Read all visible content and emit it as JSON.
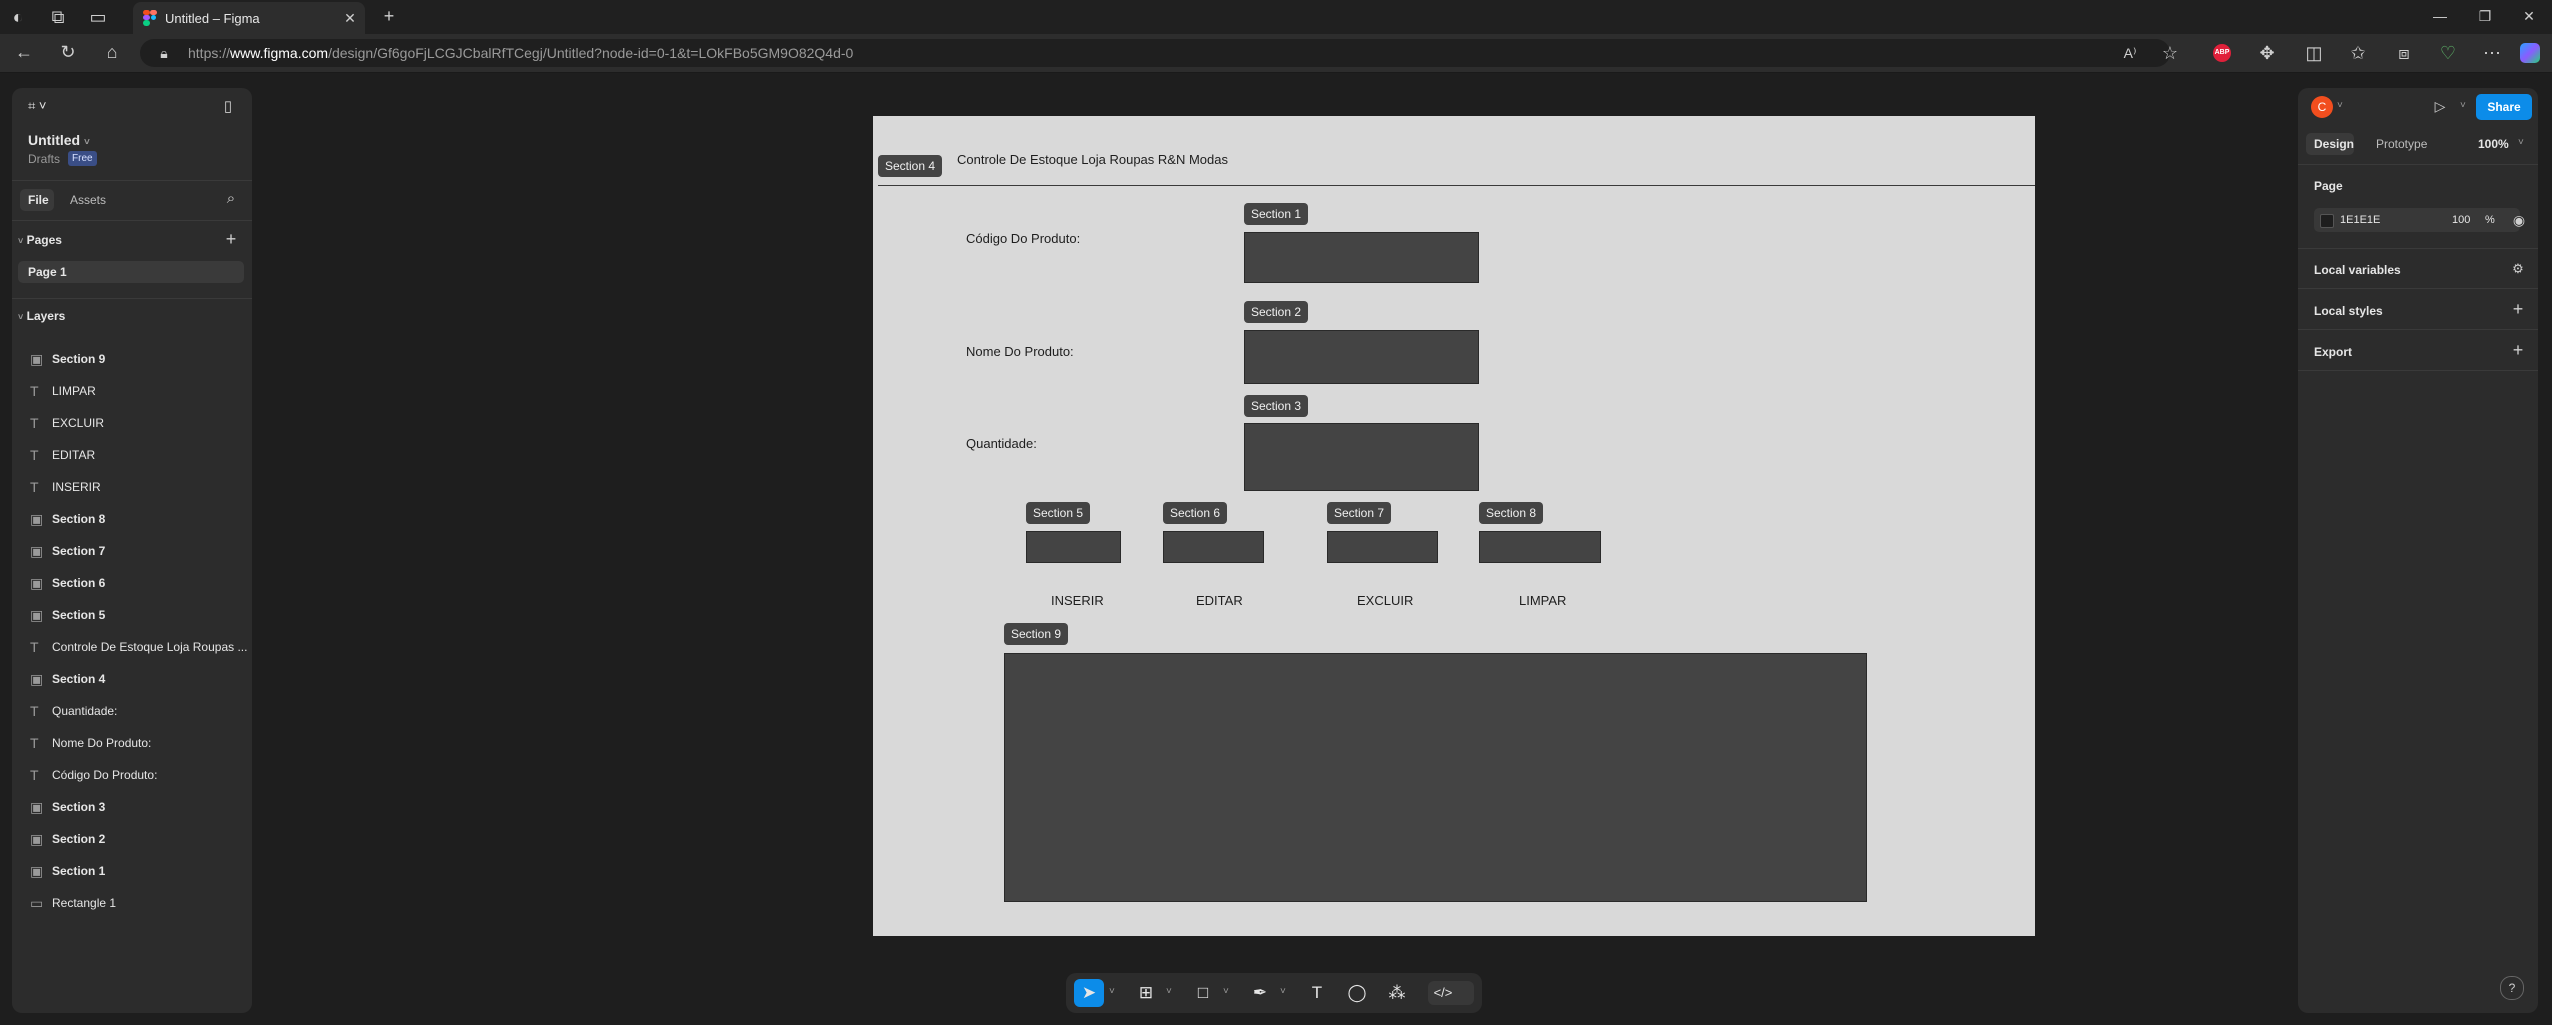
{
  "browser": {
    "tab_title": "Untitled – Figma",
    "new_tab_icon": "plus-icon",
    "url_prefix": "https://",
    "url_host": "www.figma.com",
    "url_path": "/design/Gf6goFjLCGJCbalRfTCegj/Untitled?node-id=0-1&t=LOkFBo5GM9O82Q4d-0",
    "ext_badge": "ABP"
  },
  "file": {
    "name": "Untitled",
    "location": "Drafts",
    "plan_badge": "Free"
  },
  "left_panel": {
    "tabs": [
      "File",
      "Assets"
    ],
    "pages_heading": "Pages",
    "current_page": "Page 1",
    "layers_heading": "Layers",
    "layers": [
      {
        "label": "Section 9",
        "kind": "frame"
      },
      {
        "label": "LIMPAR",
        "kind": "text"
      },
      {
        "label": "EXCLUIR",
        "kind": "text"
      },
      {
        "label": "EDITAR",
        "kind": "text"
      },
      {
        "label": "INSERIR",
        "kind": "text"
      },
      {
        "label": "Section 8",
        "kind": "frame"
      },
      {
        "label": "Section 7",
        "kind": "frame"
      },
      {
        "label": "Section 6",
        "kind": "frame"
      },
      {
        "label": "Section 5",
        "kind": "frame"
      },
      {
        "label": "Controle De Estoque Loja Roupas ...",
        "kind": "text"
      },
      {
        "label": "Section 4",
        "kind": "frame"
      },
      {
        "label": "Quantidade:",
        "kind": "text"
      },
      {
        "label": "Nome Do Produto:",
        "kind": "text"
      },
      {
        "label": "Código Do Produto:",
        "kind": "text"
      },
      {
        "label": "Section 3",
        "kind": "frame"
      },
      {
        "label": "Section 2",
        "kind": "frame"
      },
      {
        "label": "Section 1",
        "kind": "frame"
      },
      {
        "label": "Rectangle 1",
        "kind": "rect"
      }
    ]
  },
  "right_panel": {
    "avatar_letter": "C",
    "share_label": "Share",
    "tabs": [
      "Design",
      "Prototype"
    ],
    "zoom": "100%",
    "page_heading": "Page",
    "page_color": "1E1E1E",
    "page_opacity": "100",
    "percent_sign": "%",
    "sections": [
      "Local variables",
      "Local styles",
      "Export"
    ],
    "help": "?"
  },
  "canvas": {
    "title": "Controle De Estoque Loja Roupas R&N Modas",
    "sections": {
      "s1": "Section 1",
      "s2": "Section 2",
      "s3": "Section 3",
      "s4": "Section 4",
      "s5": "Section 5",
      "s6": "Section 6",
      "s7": "Section 7",
      "s8": "Section 8",
      "s9": "Section 9"
    },
    "labels": {
      "codigo": "Código Do Produto:",
      "nome": "Nome Do Produto:",
      "quantidade": "Quantidade:"
    },
    "buttons": {
      "inserir": "INSERIR",
      "editar": "EDITAR",
      "excluir": "EXCLUIR",
      "limpar": "LIMPAR"
    }
  },
  "colors": {
    "canvas_bg": "#1e1e1e",
    "frame_bg": "#d9d9d9",
    "section_fill": "#444444",
    "accent_blue": "#0c8ce9",
    "avatar_orange": "#f24e1e"
  }
}
